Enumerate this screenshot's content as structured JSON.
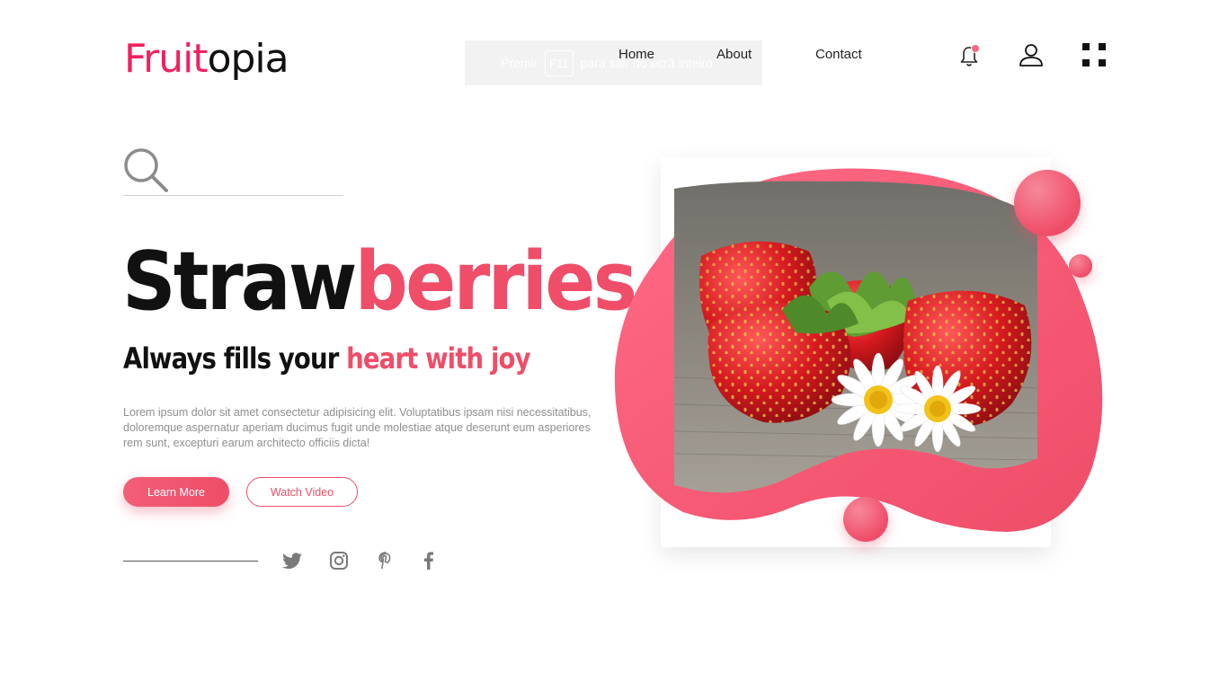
{
  "brand": {
    "part1": "Fruit",
    "part2": "opia"
  },
  "fullscreen_toast": {
    "prefix": "Premir",
    "key": "F11",
    "suffix": "para sair do ecrã inteiro"
  },
  "nav": {
    "home": "Home",
    "about": "About",
    "contact": "Contact"
  },
  "search": {
    "placeholder": ""
  },
  "hero": {
    "title_dark": "Straw",
    "title_pink": "berries",
    "subtitle_dark": "Always fills your ",
    "subtitle_pink": "heart with joy",
    "description": "Lorem ipsum dolor sit amet consectetur adipisicing elit. Voluptatibus ipsam nisi necessitatibus, doloremque aspernatur aperiam ducimus fugit unde molestiae atque deserunt eum asperiores rem sunt, excepturi earum architecto officiis dicta!",
    "learn_more": "Learn More",
    "watch_video": "Watch Video"
  },
  "social": [
    "twitter-icon",
    "instagram-icon",
    "pinterest-icon",
    "facebook-icon"
  ],
  "colors": {
    "accent": "#ef4d68",
    "logo_pink": "#f0215f",
    "text": "#111111",
    "muted": "#8f8f8f"
  },
  "image": {
    "subject": "strawberries with daisies"
  }
}
